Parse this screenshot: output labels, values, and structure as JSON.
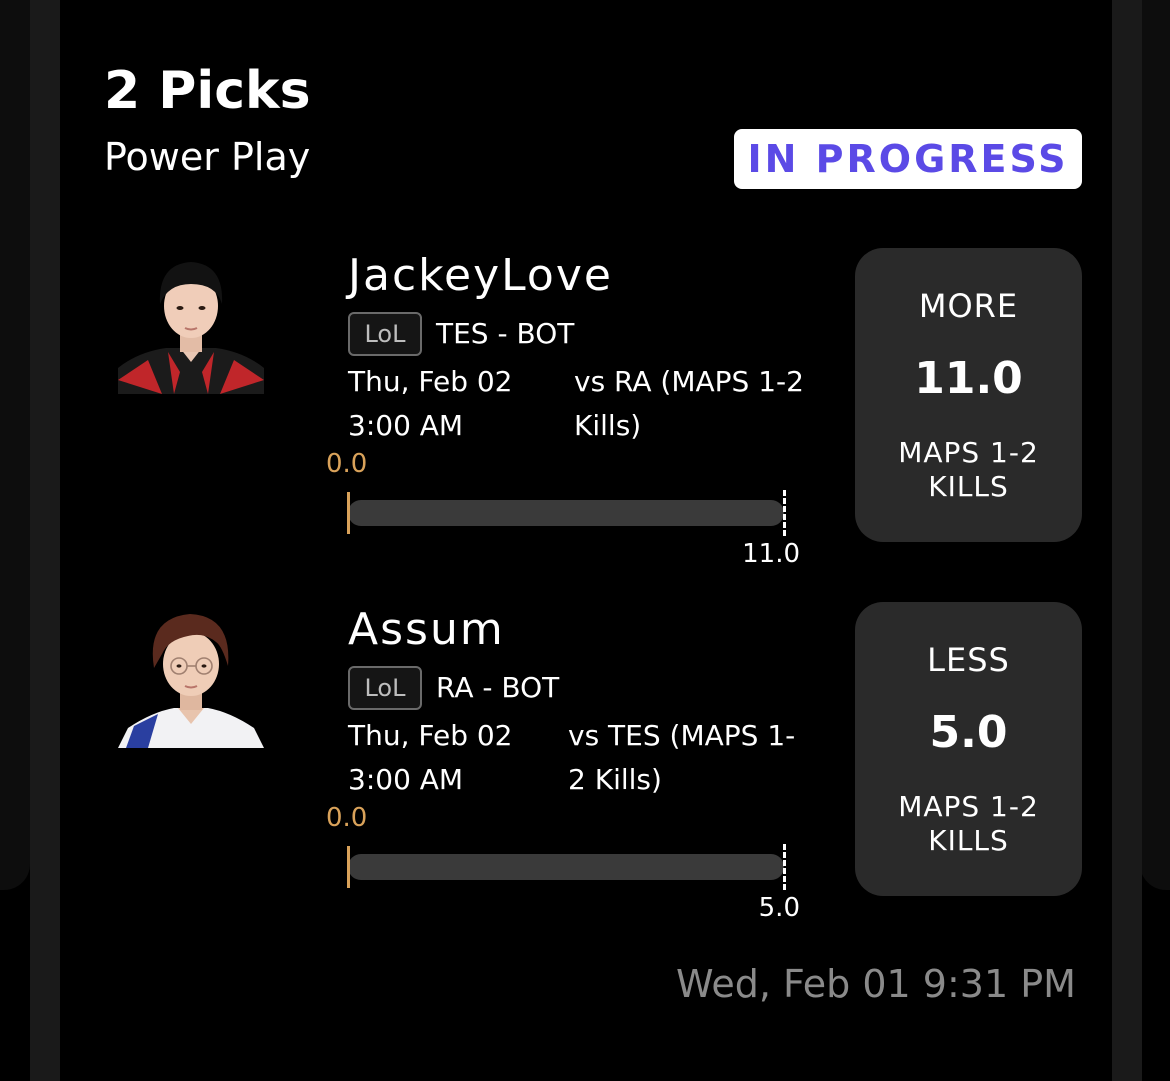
{
  "header": {
    "title": "2 Picks",
    "subtitle": "Power Play",
    "status": "IN PROGRESS"
  },
  "picks": [
    {
      "player": "JackeyLove",
      "league": "LoL",
      "team_position": "TES - BOT",
      "date": "Thu, Feb 02",
      "time": "3:00 AM",
      "matchup": "vs RA (MAPS 1-2 Kills)",
      "progress": {
        "current_label": "0.0",
        "target_label": "11.0",
        "current": 0.0,
        "target": 11.0
      },
      "box": {
        "direction": "MORE",
        "line": "11.0",
        "stat": "MAPS 1-2 KILLS"
      }
    },
    {
      "player": "Assum",
      "league": "LoL",
      "team_position": "RA - BOT",
      "date": "Thu, Feb 02",
      "time": "3:00 AM",
      "matchup": "vs TES (MAPS 1-2 Kills)",
      "progress": {
        "current_label": "0.0",
        "target_label": "5.0",
        "current": 0.0,
        "target": 5.0
      },
      "box": {
        "direction": "LESS",
        "line": "5.0",
        "stat": "MAPS 1-2 KILLS"
      }
    }
  ],
  "footer": {
    "timestamp": "Wed, Feb 01 9:31 PM"
  },
  "colors": {
    "background": "#000000",
    "status_text": "#5b4ae6",
    "progress_accent": "#d9a25a",
    "pick_box": "#2a2a2a"
  },
  "icons": [
    "player-avatar-jackeylove-icon",
    "player-avatar-assum-icon"
  ]
}
